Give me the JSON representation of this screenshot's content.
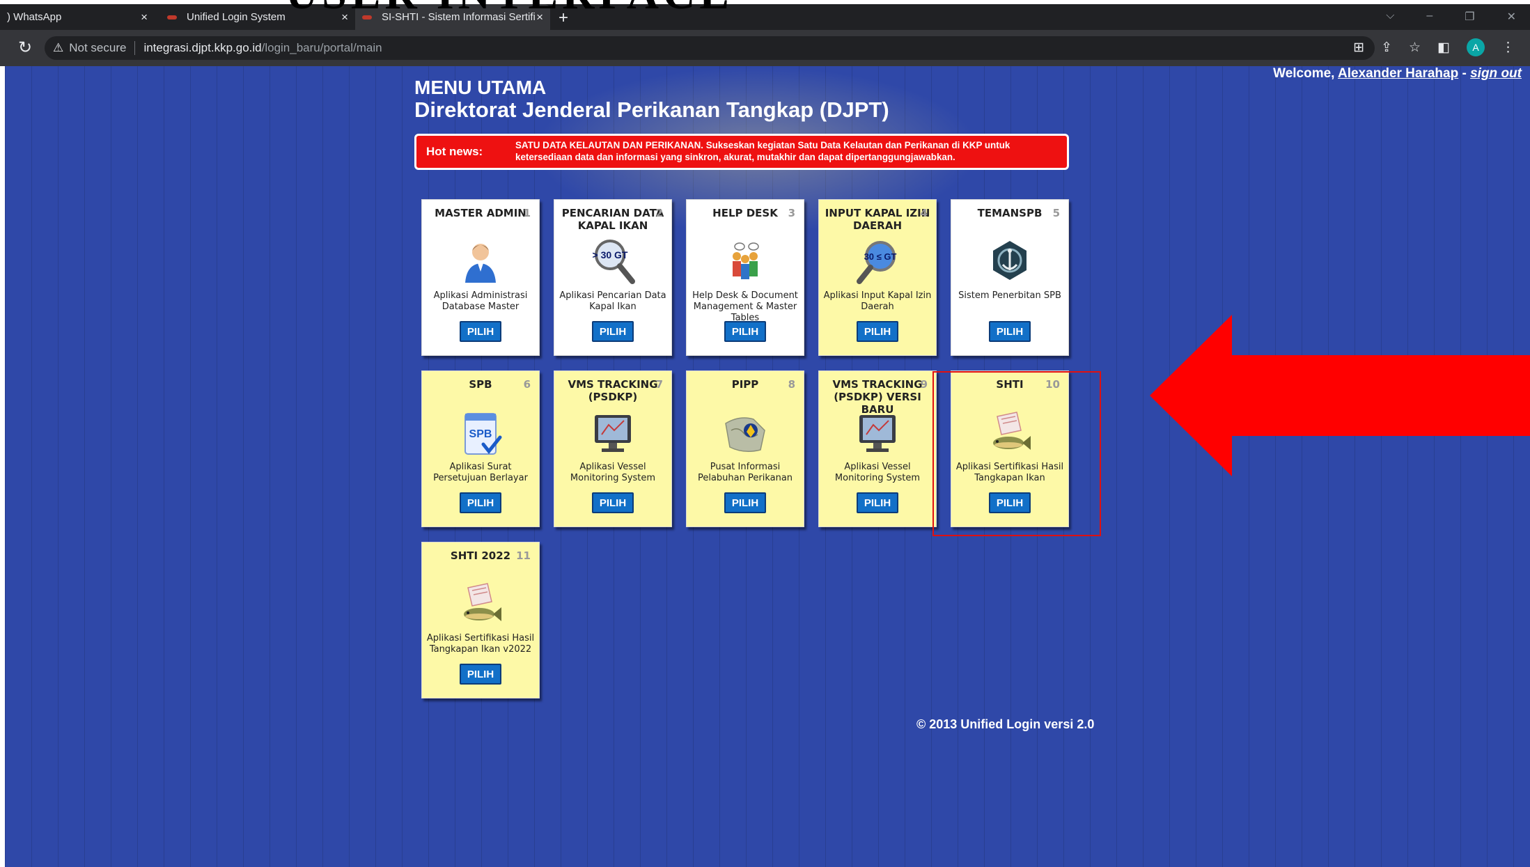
{
  "overlay_text": "USER INTERFACE",
  "browser": {
    "tabs": [
      {
        "title": ") WhatsApp",
        "close": "×"
      },
      {
        "title": "Unified Login System",
        "close": "×"
      },
      {
        "title": "SI-SHTI - Sistem Informasi Sertifi",
        "close": "×"
      }
    ],
    "new_tab": "+",
    "address": {
      "security": "Not secure",
      "host": "integrasi.djpt.kkp.go.id",
      "path": "/login_baru/portal/main"
    },
    "profile_initial": "A"
  },
  "header": {
    "welcome_prefix": "Welcome, ",
    "user_name": "Alexander Harahap",
    "separator": " - ",
    "sign_out": "sign out",
    "title": "MENU UTAMA",
    "subtitle": "Direktorat Jenderal Perikanan Tangkap (DJPT)"
  },
  "hot_news": {
    "label": "Hot news:",
    "text": "SATU DATA KELAUTAN DAN PERIKANAN. Sukseskan kegiatan Satu Data Kelautan dan Perikanan di KKP untuk ketersediaan data dan informasi yang sinkron, akurat, mutakhir dan dapat dipertanggungjawabkan."
  },
  "cards": [
    {
      "title": "MASTER ADMIN",
      "num": "1",
      "desc": "Aplikasi Administrasi Database Master",
      "button": "PILIH",
      "color": "white",
      "icon": "user-icon"
    },
    {
      "title": "PENCARIAN DATA KAPAL IKAN",
      "num": "2",
      "desc": "Aplikasi Pencarian Data Kapal Ikan",
      "button": "PILIH",
      "color": "white",
      "icon": "magnifier-30gt-icon",
      "icon_label": "> 30 GT"
    },
    {
      "title": "HELP DESK",
      "num": "3",
      "desc": "Help Desk & Document Management & Master Tables",
      "button": "PILIH",
      "color": "white",
      "icon": "helpdesk-people-icon"
    },
    {
      "title": "INPUT KAPAL IZIN DAERAH",
      "num": "4",
      "desc": "Aplikasi Input Kapal Izin Daerah",
      "button": "PILIH",
      "color": "yellow",
      "icon": "magnifier-30gt-icon",
      "icon_label": "30 ≤ GT"
    },
    {
      "title": "TEMANSPB",
      "num": "5",
      "desc": "Sistem Penerbitan SPB",
      "button": "PILIH",
      "color": "white",
      "icon": "anchor-wheel-icon"
    },
    {
      "title": "SPB",
      "num": "6",
      "desc": "Aplikasi Surat Persetujuan Berlayar",
      "button": "PILIH",
      "color": "yellow",
      "icon": "spb-document-icon",
      "icon_label": "SPB"
    },
    {
      "title": "VMS TRACKING (PSDKP)",
      "num": "7",
      "desc": "Aplikasi Vessel Monitoring System",
      "button": "PILIH",
      "color": "yellow",
      "icon": "monitor-icon"
    },
    {
      "title": "PIPP",
      "num": "8",
      "desc": "Pusat Informasi Pelabuhan Perikanan",
      "button": "PILIH",
      "color": "yellow",
      "icon": "pipp-map-icon"
    },
    {
      "title": "VMS TRACKING (PSDKP) VERSI BARU",
      "num": "9",
      "desc": "Aplikasi Vessel Monitoring System",
      "button": "PILIH",
      "color": "yellow",
      "icon": "monitor-icon"
    },
    {
      "title": "SHTI",
      "num": "10",
      "desc": "Aplikasi Sertifikasi Hasil Tangkapan Ikan",
      "button": "PILIH",
      "color": "yellow",
      "icon": "fish-certificate-icon"
    },
    {
      "title": "SHTI 2022",
      "num": "11",
      "desc": "Aplikasi Sertifikasi Hasil Tangkapan Ikan v2022",
      "button": "PILIH",
      "color": "yellow",
      "icon": "fish-certificate-icon"
    }
  ],
  "footer": "© 2013 Unified Login versi 2.0",
  "colors": {
    "page_bg": "#2f48a8",
    "hot_news_bg": "#ee1111",
    "card_yellow": "#fdf9a7",
    "button": "#1270c8",
    "highlight": "#e01010"
  }
}
